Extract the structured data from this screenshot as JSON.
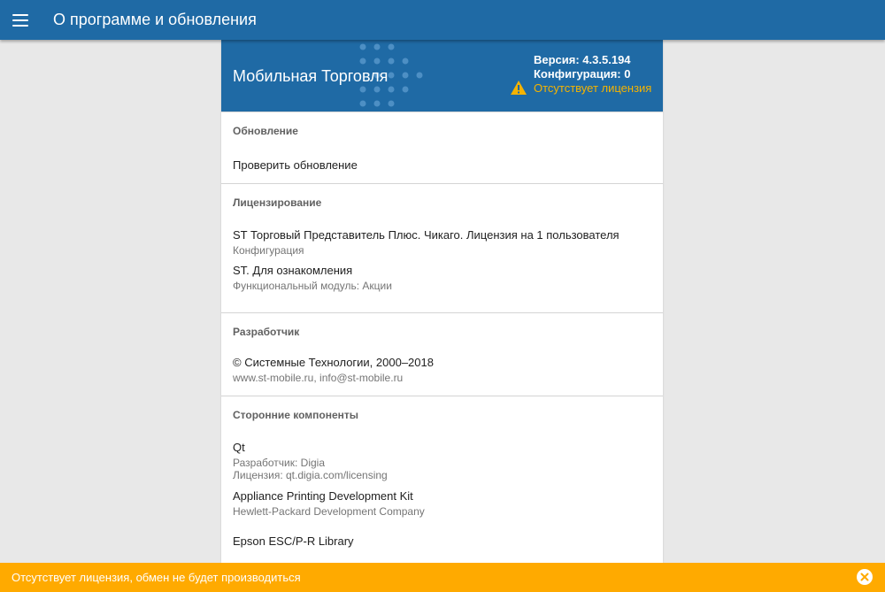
{
  "appbar": {
    "title": "О программе и обновления",
    "menu_icon": "hamburger-menu-icon"
  },
  "hero": {
    "app_name": "Мобильная Торговля",
    "version": "Версия: 4.3.5.194",
    "configuration": "Конфигурация: 0",
    "license_warning": "Отсутствует лицензия",
    "warning_icon": "warning-triangle-icon",
    "colors": {
      "background": "#1f6aa5",
      "warning": "#f5b300"
    }
  },
  "sections": {
    "update": {
      "header": "Обновление",
      "check_update": "Проверить обновление"
    },
    "licensing": {
      "header": "Лицензирование",
      "items": [
        {
          "title": "ST Торговый Представитель Плюс. Чикаго. Лицензия на 1 пользователя",
          "sub": "Конфигурация"
        },
        {
          "title": "ST. Для ознакомления",
          "sub": "Функциональный модуль: Акции"
        }
      ]
    },
    "developer": {
      "header": "Разработчик",
      "title": "© Системные Технологии, 2000–2018",
      "sub": "www.st-mobile.ru, info@st-mobile.ru"
    },
    "third_party": {
      "header": "Сторонние компоненты",
      "items": [
        {
          "title": "Qt",
          "sub1": "Разработчик: Digia",
          "sub2": "Лицензия: qt.digia.com/licensing"
        },
        {
          "title": "Appliance Printing Development Kit",
          "sub1": "Hewlett-Packard Development Company"
        },
        {
          "title": "Epson ESC/P-R Library"
        }
      ]
    }
  },
  "banner": {
    "text": "Отсутствует лицензия, обмен не будет производиться",
    "close_icon": "close-circle-icon",
    "color": "#ffaa00"
  }
}
